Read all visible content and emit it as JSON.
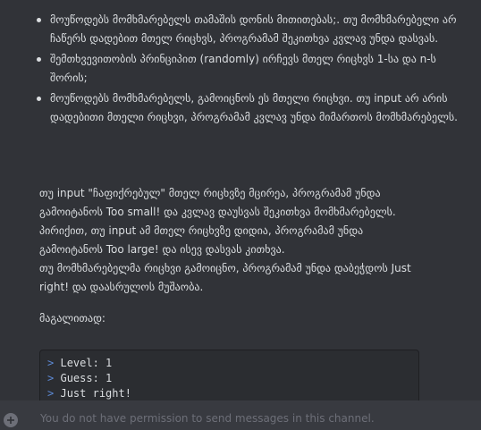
{
  "message": {
    "bullets": [
      "მოუწოდებს მომხმარებელს თამაშის დონის მითითებას;. თუ მომხმარებელი არ ჩაწერს დადებით მთელ რიცხვს, პროგრამამ შეკითხვა კვლავ უნდა დასვას.",
      "შემთხვევითობის პრინციპით (randomly) ირჩევს მთელ რიცხვს 1-სა და n-ს შორის;",
      "მოუწოდებს მომხმარებელს, გამოიცნოს ეს მთელი რიცხვი. თუ input არ არის დადებითი მთელი რიცხვი, პროგრამამ კვლავ უნდა მიმართოს მომხმარებელს."
    ],
    "paragraph_lines": [
      "თუ input \"ჩაფიქრებულ\" მთელ რიცხვზე მცირეა, პროგრამამ უნდა",
      "გამოიტანოს Too small! და კვლავ დაუსვას შეკითხვა მომხმარებელს.",
      "პირიქით, თუ input ამ მთელ რიცხვზე დიდია, პროგრამამ უნდა",
      "გამოიტანოს Too large! და ისევ დასვას კითხვა.",
      "თუ მომხმარებელმა რიცხვი გამოიცნო, პროგრამამ უნდა დაბეჭდოს Just",
      "right! და დაასრულოს მუშაობა."
    ],
    "example_label": "მაგალითად:",
    "code_lines": [
      {
        "prompt": ">",
        "text": "Level: 1"
      },
      {
        "prompt": ">",
        "text": "Guess: 1"
      },
      {
        "prompt": ">",
        "text": "Just right!"
      }
    ]
  },
  "composer": {
    "notice": "You do not have permission to send messages in this channel."
  },
  "colors": {
    "background": "#313338",
    "composer_background": "#383a40",
    "code_background": "#2b2d31",
    "prompt_accent": "#5d8ad6"
  },
  "icons": {
    "composer_add": "plus-circle-icon"
  }
}
